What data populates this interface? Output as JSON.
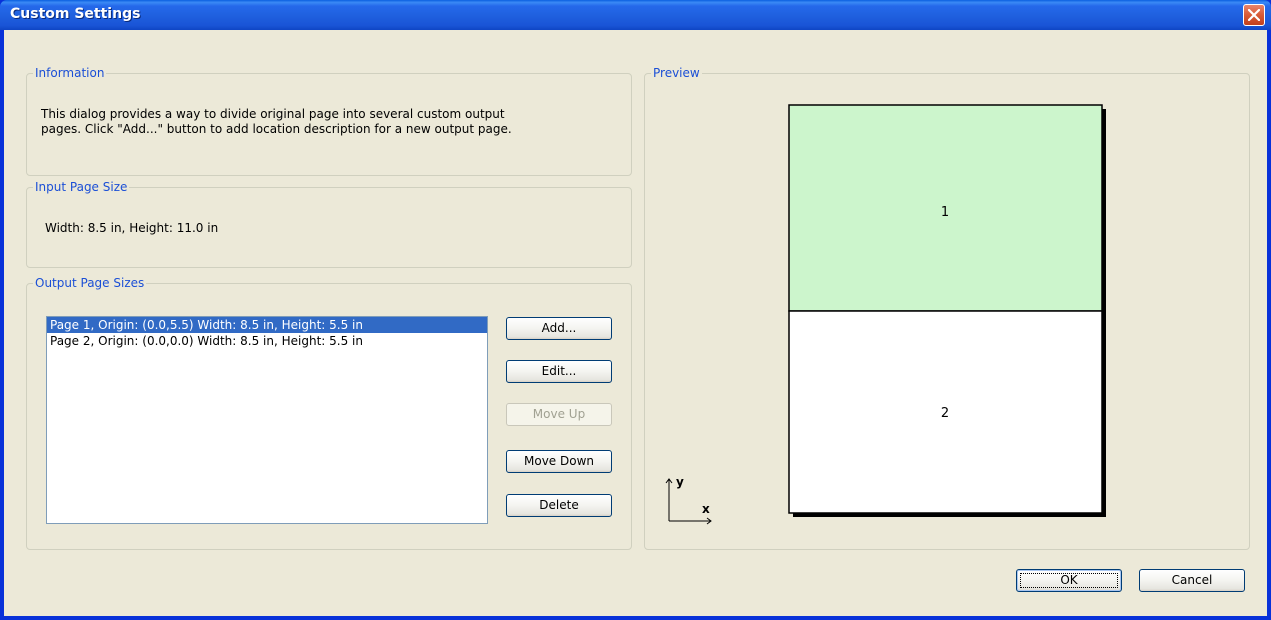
{
  "window": {
    "title": "Custom Settings"
  },
  "information": {
    "legend": "Information",
    "text_line1": "This dialog provides a way to divide original page into several custom output",
    "text_line2": "pages. Click \"Add...\" button to add location description for a new output page."
  },
  "input_page": {
    "legend": "Input Page Size",
    "text": "Width: 8.5 in, Height: 11.0 in"
  },
  "output_pages": {
    "legend": "Output Page Sizes",
    "items": [
      {
        "label": "Page 1, Origin: (0.0,5.5) Width: 8.5 in, Height: 5.5 in",
        "selected": true
      },
      {
        "label": "Page 2, Origin: (0.0,0.0) Width: 8.5 in, Height: 5.5 in",
        "selected": false
      }
    ],
    "buttons": {
      "add": "Add...",
      "edit": "Edit...",
      "move_up": "Move Up",
      "move_down": "Move Down",
      "delete": "Delete"
    }
  },
  "preview": {
    "legend": "Preview",
    "page1_label": "1",
    "page2_label": "2",
    "page1_color": "#ccf5cc",
    "page2_color": "#ffffff",
    "axis_y": "y",
    "axis_x": "x"
  },
  "footer": {
    "ok": "OK",
    "cancel": "Cancel"
  }
}
